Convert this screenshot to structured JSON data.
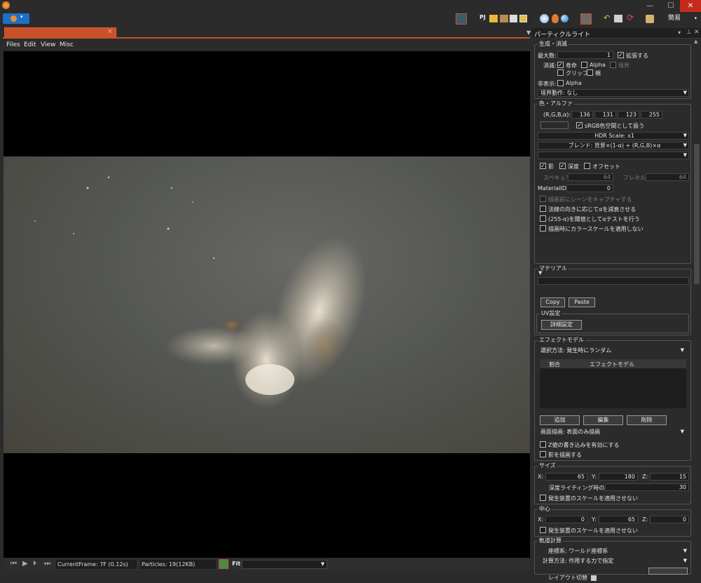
{
  "app": {
    "lang_button": "簡易"
  },
  "menu": {
    "files": "Files",
    "edit": "Edit",
    "view": "View",
    "misc": "Misc"
  },
  "status": {
    "current_frame": "CurrentFrame: 7F (0.12s)",
    "particles": "Particles: 19(12KB)",
    "fit": "Fit"
  },
  "panel": {
    "title": "パーティクルライト",
    "gen": {
      "title": "生成・消滅",
      "max_label": "最大数:",
      "max_value": "1",
      "expand": "拡張する",
      "vanish_label": "消滅:",
      "lifespan": "寿命",
      "alpha": "Alpha",
      "border": "境界",
      "clip": "クリップ",
      "parent": "親",
      "hide_label": "非表示:",
      "hide_alpha": "Alpha",
      "border_action": "境界動作: なし"
    },
    "color": {
      "title": "色・アルファ",
      "rgba_label": "(R,G,B,α):",
      "r": "136",
      "g": "131",
      "b": "123",
      "a": "255",
      "srgb": "sRGB色空間として扱う",
      "hdr": "HDR Scale: x1",
      "blend": "ブレンド: 背景×(1-α) + (R,G,B)×α",
      "shadow": "影",
      "depth": "深度",
      "offset": "オフセット",
      "specular_label": "スペキュラ:",
      "specular_value": "64",
      "fresnel_label": "フレネル:",
      "fresnel_value": "64",
      "material_id_label": "MaterialID:",
      "material_id_value": "0",
      "capture": "描画前にシーンをキャプチャする",
      "normal_fade": "法線の向きに応じてαを減衰させる",
      "alpha_test": "(255-α)を閾値としてαテストを行う",
      "no_colorscale": "描画時にカラースケールを適用しない"
    },
    "material": {
      "title": "マテリアル",
      "copy": "Copy",
      "paste": "Paste",
      "uv_title": "UV設定",
      "uv_detail": "詳細設定"
    },
    "effect": {
      "title": "エフェクトモデル",
      "method": "選択方法: 発生時にランダム",
      "col_ratio": "割合",
      "col_model": "エフェクトモデル",
      "add": "追加",
      "edit": "編集",
      "delete": "削除",
      "screen": "画面描画: 表面のみ描画",
      "zwrite": "Z値の書き込みを有効にする",
      "shadow": "影を描画する"
    },
    "size": {
      "title": "サイズ",
      "x": "65",
      "y": "180",
      "z": "15",
      "depth_label": "深度ライティング時の厚さ:",
      "depth_value": "30",
      "noscale": "発生装置のスケールを適用させない"
    },
    "center": {
      "title": "中心",
      "x": "0",
      "y": "65",
      "z": "0",
      "noscale": "発生装置のスケールを適用させない"
    },
    "orbit": {
      "title": "軌道計算",
      "coord": "座標系: ワールド座標系",
      "calc": "計算方法: 作用する力で指定"
    },
    "xyz": {
      "x": "X:",
      "y": "Y:",
      "z": "Z:"
    }
  },
  "layout_toggle": "レイアウト切替",
  "colors": {
    "accent": "#c8512a",
    "background": "#2b2b2b",
    "swatch": "#887b7b"
  }
}
